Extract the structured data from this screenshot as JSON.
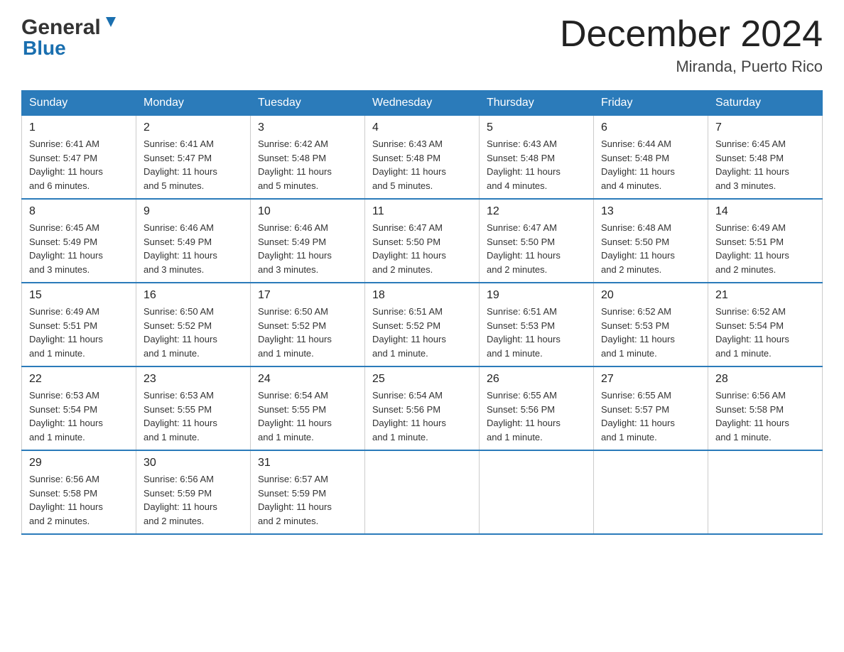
{
  "header": {
    "logo_general": "General",
    "logo_blue": "Blue",
    "month_title": "December 2024",
    "location": "Miranda, Puerto Rico"
  },
  "days_of_week": [
    "Sunday",
    "Monday",
    "Tuesday",
    "Wednesday",
    "Thursday",
    "Friday",
    "Saturday"
  ],
  "weeks": [
    [
      {
        "day": "1",
        "sunrise": "6:41 AM",
        "sunset": "5:47 PM",
        "daylight": "11 hours and 6 minutes."
      },
      {
        "day": "2",
        "sunrise": "6:41 AM",
        "sunset": "5:47 PM",
        "daylight": "11 hours and 5 minutes."
      },
      {
        "day": "3",
        "sunrise": "6:42 AM",
        "sunset": "5:48 PM",
        "daylight": "11 hours and 5 minutes."
      },
      {
        "day": "4",
        "sunrise": "6:43 AM",
        "sunset": "5:48 PM",
        "daylight": "11 hours and 5 minutes."
      },
      {
        "day": "5",
        "sunrise": "6:43 AM",
        "sunset": "5:48 PM",
        "daylight": "11 hours and 4 minutes."
      },
      {
        "day": "6",
        "sunrise": "6:44 AM",
        "sunset": "5:48 PM",
        "daylight": "11 hours and 4 minutes."
      },
      {
        "day": "7",
        "sunrise": "6:45 AM",
        "sunset": "5:48 PM",
        "daylight": "11 hours and 3 minutes."
      }
    ],
    [
      {
        "day": "8",
        "sunrise": "6:45 AM",
        "sunset": "5:49 PM",
        "daylight": "11 hours and 3 minutes."
      },
      {
        "day": "9",
        "sunrise": "6:46 AM",
        "sunset": "5:49 PM",
        "daylight": "11 hours and 3 minutes."
      },
      {
        "day": "10",
        "sunrise": "6:46 AM",
        "sunset": "5:49 PM",
        "daylight": "11 hours and 3 minutes."
      },
      {
        "day": "11",
        "sunrise": "6:47 AM",
        "sunset": "5:50 PM",
        "daylight": "11 hours and 2 minutes."
      },
      {
        "day": "12",
        "sunrise": "6:47 AM",
        "sunset": "5:50 PM",
        "daylight": "11 hours and 2 minutes."
      },
      {
        "day": "13",
        "sunrise": "6:48 AM",
        "sunset": "5:50 PM",
        "daylight": "11 hours and 2 minutes."
      },
      {
        "day": "14",
        "sunrise": "6:49 AM",
        "sunset": "5:51 PM",
        "daylight": "11 hours and 2 minutes."
      }
    ],
    [
      {
        "day": "15",
        "sunrise": "6:49 AM",
        "sunset": "5:51 PM",
        "daylight": "11 hours and 1 minute."
      },
      {
        "day": "16",
        "sunrise": "6:50 AM",
        "sunset": "5:52 PM",
        "daylight": "11 hours and 1 minute."
      },
      {
        "day": "17",
        "sunrise": "6:50 AM",
        "sunset": "5:52 PM",
        "daylight": "11 hours and 1 minute."
      },
      {
        "day": "18",
        "sunrise": "6:51 AM",
        "sunset": "5:52 PM",
        "daylight": "11 hours and 1 minute."
      },
      {
        "day": "19",
        "sunrise": "6:51 AM",
        "sunset": "5:53 PM",
        "daylight": "11 hours and 1 minute."
      },
      {
        "day": "20",
        "sunrise": "6:52 AM",
        "sunset": "5:53 PM",
        "daylight": "11 hours and 1 minute."
      },
      {
        "day": "21",
        "sunrise": "6:52 AM",
        "sunset": "5:54 PM",
        "daylight": "11 hours and 1 minute."
      }
    ],
    [
      {
        "day": "22",
        "sunrise": "6:53 AM",
        "sunset": "5:54 PM",
        "daylight": "11 hours and 1 minute."
      },
      {
        "day": "23",
        "sunrise": "6:53 AM",
        "sunset": "5:55 PM",
        "daylight": "11 hours and 1 minute."
      },
      {
        "day": "24",
        "sunrise": "6:54 AM",
        "sunset": "5:55 PM",
        "daylight": "11 hours and 1 minute."
      },
      {
        "day": "25",
        "sunrise": "6:54 AM",
        "sunset": "5:56 PM",
        "daylight": "11 hours and 1 minute."
      },
      {
        "day": "26",
        "sunrise": "6:55 AM",
        "sunset": "5:56 PM",
        "daylight": "11 hours and 1 minute."
      },
      {
        "day": "27",
        "sunrise": "6:55 AM",
        "sunset": "5:57 PM",
        "daylight": "11 hours and 1 minute."
      },
      {
        "day": "28",
        "sunrise": "6:56 AM",
        "sunset": "5:58 PM",
        "daylight": "11 hours and 1 minute."
      }
    ],
    [
      {
        "day": "29",
        "sunrise": "6:56 AM",
        "sunset": "5:58 PM",
        "daylight": "11 hours and 2 minutes."
      },
      {
        "day": "30",
        "sunrise": "6:56 AM",
        "sunset": "5:59 PM",
        "daylight": "11 hours and 2 minutes."
      },
      {
        "day": "31",
        "sunrise": "6:57 AM",
        "sunset": "5:59 PM",
        "daylight": "11 hours and 2 minutes."
      },
      null,
      null,
      null,
      null
    ]
  ],
  "labels": {
    "sunrise": "Sunrise:",
    "sunset": "Sunset:",
    "daylight": "Daylight:"
  }
}
